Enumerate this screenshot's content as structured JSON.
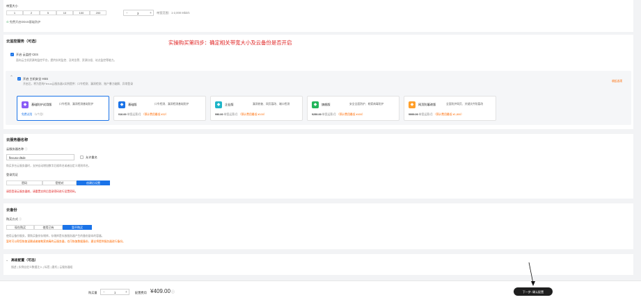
{
  "bandwidth": {
    "label": "带宽大小",
    "options": [
      "1",
      "2",
      "5",
      "10",
      "100",
      "200"
    ],
    "stepper_value": "3",
    "range_text": "带宽范围：1-2,000 Mbit/s",
    "ddos_note": "免费开启DDoS基础防护"
  },
  "monitor_section": {
    "title": "云监控服务（可选）",
    "annotation": "实操购买第四步：确定相关带宽大小及云备份是否开启",
    "ces_label": "开启 云监控 CES",
    "ces_desc": "面向云主机资源的监控平台，提供实时监控、及时告警、资源分组、站点监控等能力。",
    "hss_label": "开启 主机安全 HSS",
    "hss_desc": "开启后，将为您的Flexus云服务器X实例提供：口令检测、漏洞检测、账户暴力破解、异常登录",
    "collapse_link": "收起选项",
    "products": [
      {
        "name": "基础防护试用版",
        "desc": "口令检测、漏洞检测基础防护",
        "price": "免费试用",
        "period": "（1个月）",
        "promo": ""
      },
      {
        "name": "基础版",
        "desc": "口令检测、漏洞检测基础防护",
        "price": "¥10.00",
        "period": "带宽运营/月",
        "promo": "（预计费用最低 ¥32）"
      },
      {
        "name": "企业版",
        "desc": "漏洞修复、网页篡改、端口检测",
        "price": "¥90.00",
        "period": "带宽运营/月",
        "promo": "（预计费用最低 ¥100）"
      },
      {
        "name": "旗舰版",
        "desc": "安全全面防护、勒索病毒防护",
        "price": "¥250.00",
        "period": "带宽运营/月",
        "promo": "（预计费用最低 ¥400）"
      },
      {
        "name": "网页防篡改版",
        "desc": "全面防护网页、关键文件防篡改",
        "price": "¥999.00",
        "period": "带宽运营/月",
        "promo": "（预计费用最低 ¥1,800）"
      }
    ]
  },
  "server_name": {
    "title": "云服务器名称",
    "field_label": "云服务器名称",
    "value": "flexusx-d5de",
    "allow_dup": "允许重名",
    "hint": "购买多台云服务器时，支持自动增加数字后缀命名或者自定义规则命名。",
    "login_label": "登录凭证",
    "login_options": [
      "密码",
      "密钥对",
      "创建后设置"
    ],
    "warning": "请您登录云服务器前，请重置实例后登录密码进行设置密码。"
  },
  "backup": {
    "title": "云备份",
    "mode_label": "购买方式",
    "options": [
      "现在购买",
      "使用已有",
      "暂不购买"
    ],
    "desc1": "使用云备份服务，需购买备份存储库，存储库是存放服务器产生的备份副本的容器。",
    "desc2": "暂时可以帮您恢复误删或者被勒索病毒的云服务器，也可恢复数据备份，建议将提供服务器进行备份。"
  },
  "advanced": {
    "title": "高级配置（可选）",
    "desc": "描述 | 实例自定义数据注入 | 标签 | 委托 | 云服务器组"
  },
  "footer": {
    "qty_label": "购买量",
    "qty_value": "1",
    "cost_label": "配置费用",
    "cost_value": "¥409.00",
    "next_button": "下一步: 确认配置"
  },
  "colors": {
    "accent": "#1a73e8",
    "annotation": "#e02424",
    "promo": "#ff6a00",
    "purple_icon": "#8a5cf6",
    "blue_icon": "#1a73e8",
    "teal_icon": "#1fb5c8",
    "green_icon": "#22b55a",
    "orange_icon": "#ff9f2a"
  }
}
